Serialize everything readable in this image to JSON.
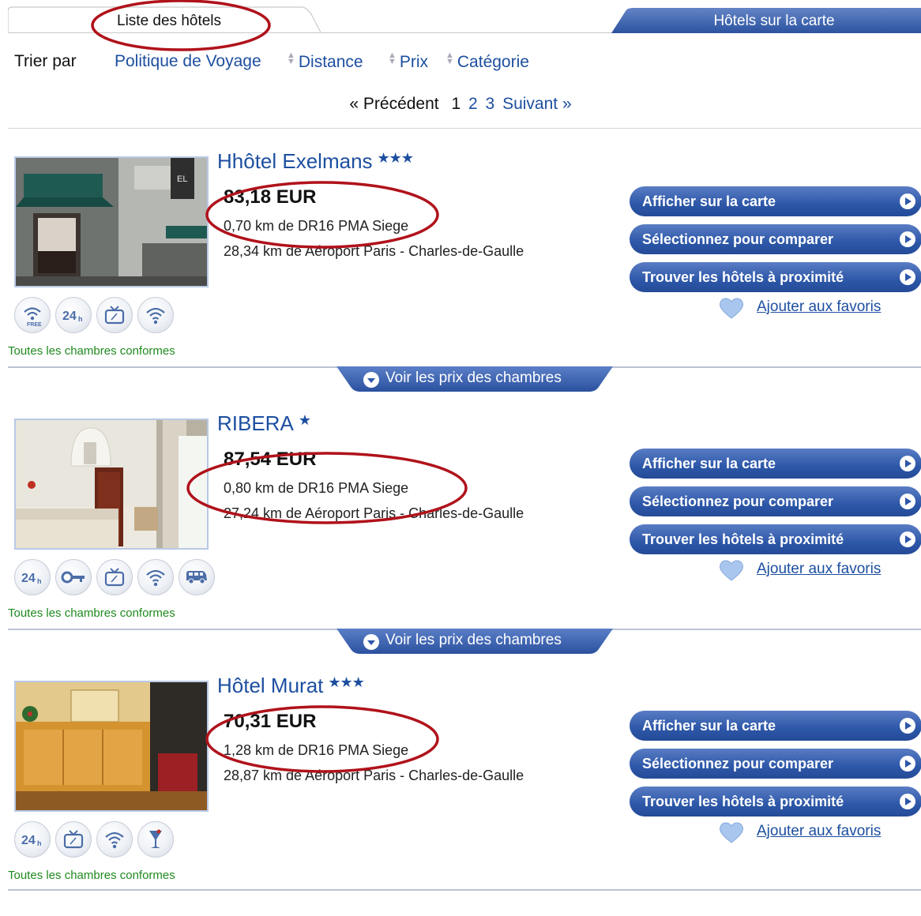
{
  "tabs": {
    "list_label": "Liste des hôtels",
    "map_label": "Hôtels sur la carte"
  },
  "sort": {
    "label": "Trier par",
    "options": [
      "Politique de Voyage",
      "Distance",
      "Prix",
      "Catégorie"
    ]
  },
  "pagination": {
    "prev": "« Précédent",
    "current": "1",
    "pages": [
      "2",
      "3"
    ],
    "next": "Suivant »"
  },
  "actions": {
    "show_map": "Afficher sur la carte",
    "compare": "Sélectionnez pour comparer",
    "nearby": "Trouver les hôtels à proximité",
    "favorite": "Ajouter aux favoris",
    "room_prices": "Voir les prix des chambres"
  },
  "hotels": [
    {
      "name": "Hhôtel Exelmans",
      "stars": "★★★",
      "price": "83,18 EUR",
      "distance_office": "0,70 km de DR16 PMA Siege",
      "distance_airport": "28,34 km de Aéroport Paris - Charles-de-Gaulle",
      "compliance": "Toutes les chambres conformes",
      "amenities": [
        "wifi-free-icon",
        "24h-icon",
        "tv-icon",
        "wifi-icon"
      ]
    },
    {
      "name": "RIBERA",
      "stars": "★",
      "price": "87,54 EUR",
      "distance_office": "0,80 km de DR16 PMA Siege",
      "distance_airport": "27,24 km de Aéroport Paris - Charles-de-Gaulle",
      "compliance": "Toutes les chambres conformes",
      "amenities": [
        "24h-icon",
        "key-icon",
        "tv-icon",
        "wifi-icon",
        "shuttle-icon"
      ]
    },
    {
      "name": "Hôtel Murat",
      "stars": "★★★",
      "price": "70,31 EUR",
      "distance_office": "1,28 km de DR16 PMA Siege",
      "distance_airport": "28,87 km de Aéroport Paris - Charles-de-Gaulle",
      "compliance": "Toutes les chambres conformes",
      "amenities": [
        "24h-icon",
        "tv-icon",
        "wifi-icon",
        "bar-icon"
      ]
    }
  ],
  "colors": {
    "link_blue": "#1d4fa0",
    "button_blue": "#2d57a8",
    "annotation_red": "#b0121b",
    "compliance_green": "#1f8a1f"
  }
}
